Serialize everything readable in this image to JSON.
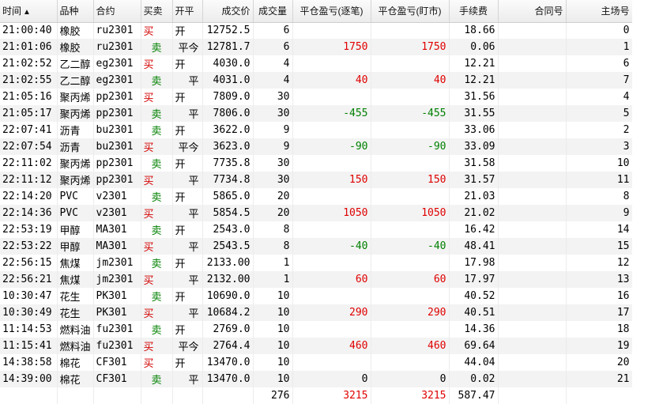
{
  "columns": [
    "时间",
    "品种",
    "合约",
    "买卖",
    "开平",
    "成交价",
    "成交量",
    "平仓盈亏(逐笔)",
    "平仓盈亏(盯市)",
    "手续费",
    "合同号",
    "主场号"
  ],
  "sort_indicator": "▲",
  "trades": [
    {
      "time": "21:00:40",
      "product": "橡胶",
      "contract": "ru2301",
      "side": "买",
      "oc": "开",
      "price": "12752.5",
      "qty": "6",
      "pnl_trade": "",
      "pnl_mtm": "",
      "fee": "18.66",
      "contract_no": "",
      "seat": "0"
    },
    {
      "time": "21:01:06",
      "product": "橡胶",
      "contract": "ru2301",
      "side": "卖",
      "oc": "平今",
      "price": "12781.7",
      "qty": "6",
      "pnl_trade": "1750",
      "pnl_mtm": "1750",
      "fee": "0.06",
      "contract_no": "",
      "seat": "1"
    },
    {
      "time": "21:02:52",
      "product": "乙二醇",
      "contract": "eg2301",
      "side": "买",
      "oc": "开",
      "price": "4030.0",
      "qty": "4",
      "pnl_trade": "",
      "pnl_mtm": "",
      "fee": "12.21",
      "contract_no": "",
      "seat": "6"
    },
    {
      "time": "21:02:55",
      "product": "乙二醇",
      "contract": "eg2301",
      "side": "卖",
      "oc": "平",
      "price": "4031.0",
      "qty": "4",
      "pnl_trade": "40",
      "pnl_mtm": "40",
      "fee": "12.21",
      "contract_no": "",
      "seat": "7"
    },
    {
      "time": "21:05:16",
      "product": "聚丙烯",
      "contract": "pp2301",
      "side": "买",
      "oc": "开",
      "price": "7809.0",
      "qty": "30",
      "pnl_trade": "",
      "pnl_mtm": "",
      "fee": "31.56",
      "contract_no": "",
      "seat": "4"
    },
    {
      "time": "21:05:17",
      "product": "聚丙烯",
      "contract": "pp2301",
      "side": "卖",
      "oc": "平",
      "price": "7806.0",
      "qty": "30",
      "pnl_trade": "-455",
      "pnl_mtm": "-455",
      "fee": "31.55",
      "contract_no": "",
      "seat": "5"
    },
    {
      "time": "22:07:41",
      "product": "沥青",
      "contract": "bu2301",
      "side": "卖",
      "oc": "开",
      "price": "3622.0",
      "qty": "9",
      "pnl_trade": "",
      "pnl_mtm": "",
      "fee": "33.06",
      "contract_no": "",
      "seat": "2"
    },
    {
      "time": "22:07:54",
      "product": "沥青",
      "contract": "bu2301",
      "side": "买",
      "oc": "平今",
      "price": "3623.0",
      "qty": "9",
      "pnl_trade": "-90",
      "pnl_mtm": "-90",
      "fee": "33.09",
      "contract_no": "",
      "seat": "3"
    },
    {
      "time": "22:11:02",
      "product": "聚丙烯",
      "contract": "pp2301",
      "side": "卖",
      "oc": "开",
      "price": "7735.8",
      "qty": "30",
      "pnl_trade": "",
      "pnl_mtm": "",
      "fee": "31.58",
      "contract_no": "",
      "seat": "10"
    },
    {
      "time": "22:11:12",
      "product": "聚丙烯",
      "contract": "pp2301",
      "side": "买",
      "oc": "平",
      "price": "7734.8",
      "qty": "30",
      "pnl_trade": "150",
      "pnl_mtm": "150",
      "fee": "31.57",
      "contract_no": "",
      "seat": "11"
    },
    {
      "time": "22:14:20",
      "product": "PVC",
      "contract": "v2301",
      "side": "卖",
      "oc": "开",
      "price": "5865.0",
      "qty": "20",
      "pnl_trade": "",
      "pnl_mtm": "",
      "fee": "21.03",
      "contract_no": "",
      "seat": "8"
    },
    {
      "time": "22:14:36",
      "product": "PVC",
      "contract": "v2301",
      "side": "买",
      "oc": "平",
      "price": "5854.5",
      "qty": "20",
      "pnl_trade": "1050",
      "pnl_mtm": "1050",
      "fee": "21.02",
      "contract_no": "",
      "seat": "9"
    },
    {
      "time": "22:53:19",
      "product": "甲醇",
      "contract": "MA301",
      "side": "卖",
      "oc": "开",
      "price": "2543.0",
      "qty": "8",
      "pnl_trade": "",
      "pnl_mtm": "",
      "fee": "16.42",
      "contract_no": "",
      "seat": "14"
    },
    {
      "time": "22:53:22",
      "product": "甲醇",
      "contract": "MA301",
      "side": "买",
      "oc": "平",
      "price": "2543.5",
      "qty": "8",
      "pnl_trade": "-40",
      "pnl_mtm": "-40",
      "fee": "48.41",
      "contract_no": "",
      "seat": "15"
    },
    {
      "time": "22:56:15",
      "product": "焦煤",
      "contract": "jm2301",
      "side": "卖",
      "oc": "开",
      "price": "2133.00",
      "qty": "1",
      "pnl_trade": "",
      "pnl_mtm": "",
      "fee": "17.98",
      "contract_no": "",
      "seat": "12"
    },
    {
      "time": "22:56:21",
      "product": "焦煤",
      "contract": "jm2301",
      "side": "买",
      "oc": "平",
      "price": "2132.00",
      "qty": "1",
      "pnl_trade": "60",
      "pnl_mtm": "60",
      "fee": "17.97",
      "contract_no": "",
      "seat": "13"
    },
    {
      "time": "10:30:47",
      "product": "花生",
      "contract": "PK301",
      "side": "卖",
      "oc": "开",
      "price": "10690.0",
      "qty": "10",
      "pnl_trade": "",
      "pnl_mtm": "",
      "fee": "40.52",
      "contract_no": "",
      "seat": "16"
    },
    {
      "time": "10:30:49",
      "product": "花生",
      "contract": "PK301",
      "side": "买",
      "oc": "平",
      "price": "10684.2",
      "qty": "10",
      "pnl_trade": "290",
      "pnl_mtm": "290",
      "fee": "40.51",
      "contract_no": "",
      "seat": "17"
    },
    {
      "time": "11:14:53",
      "product": "燃料油",
      "contract": "fu2301",
      "side": "卖",
      "oc": "开",
      "price": "2769.0",
      "qty": "10",
      "pnl_trade": "",
      "pnl_mtm": "",
      "fee": "14.36",
      "contract_no": "",
      "seat": "18"
    },
    {
      "time": "11:15:41",
      "product": "燃料油",
      "contract": "fu2301",
      "side": "买",
      "oc": "平今",
      "price": "2764.4",
      "qty": "10",
      "pnl_trade": "460",
      "pnl_mtm": "460",
      "fee": "69.64",
      "contract_no": "",
      "seat": "19"
    },
    {
      "time": "14:38:58",
      "product": "棉花",
      "contract": "CF301",
      "side": "买",
      "oc": "开",
      "price": "13470.0",
      "qty": "10",
      "pnl_trade": "",
      "pnl_mtm": "",
      "fee": "44.04",
      "contract_no": "",
      "seat": "20"
    },
    {
      "time": "14:39:00",
      "product": "棉花",
      "contract": "CF301",
      "side": "卖",
      "oc": "平",
      "price": "13470.0",
      "qty": "10",
      "pnl_trade": "0",
      "pnl_mtm": "0",
      "fee": "0.02",
      "contract_no": "",
      "seat": "21"
    }
  ],
  "totals": {
    "qty": "276",
    "pnl_trade": "3215",
    "pnl_mtm": "3215",
    "fee": "587.47"
  },
  "colors": {
    "buy": "#d40000",
    "sell": "#008000",
    "profit": "#e00000",
    "loss": "#008000",
    "row_alt": "#f3f3f3"
  }
}
